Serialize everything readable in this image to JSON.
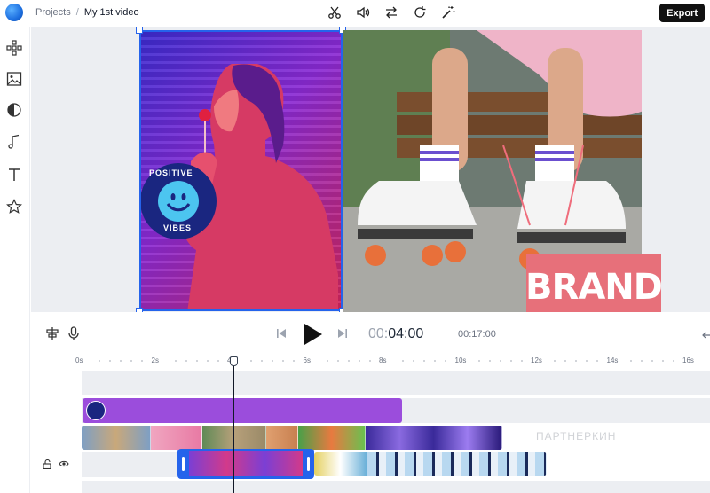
{
  "header": {
    "breadcrumb_parent": "Projects",
    "breadcrumb_separator": "/",
    "project_title": "My 1st video",
    "export_label": "Export",
    "toolbar_icons": [
      "scissors-icon",
      "volume-icon",
      "swap-icon",
      "rotate-icon",
      "magic-wand-icon"
    ]
  },
  "sidebar": {
    "items": [
      "elements-icon",
      "media-icon",
      "filters-icon",
      "music-icon",
      "text-icon",
      "star-icon"
    ]
  },
  "stage": {
    "sticker_text_top": "POSITIVE",
    "sticker_text_bottom": "VIBES",
    "brand_text": "BRAND"
  },
  "controls": {
    "time_current_prefix": "00:",
    "time_current_main": "04:00",
    "time_total": "00:17:00"
  },
  "timeline": {
    "ruler_labels": [
      "0s",
      "2s",
      "4s",
      "6s",
      "8s",
      "10s",
      "12s",
      "14s",
      "16s"
    ]
  },
  "watermark": "ПАРТНЕРКИН",
  "colors": {
    "accent": "#2563eb",
    "sticker_clip": "#9b4ddc",
    "export_bg": "#111111",
    "brand_bg": "#e7707a"
  }
}
